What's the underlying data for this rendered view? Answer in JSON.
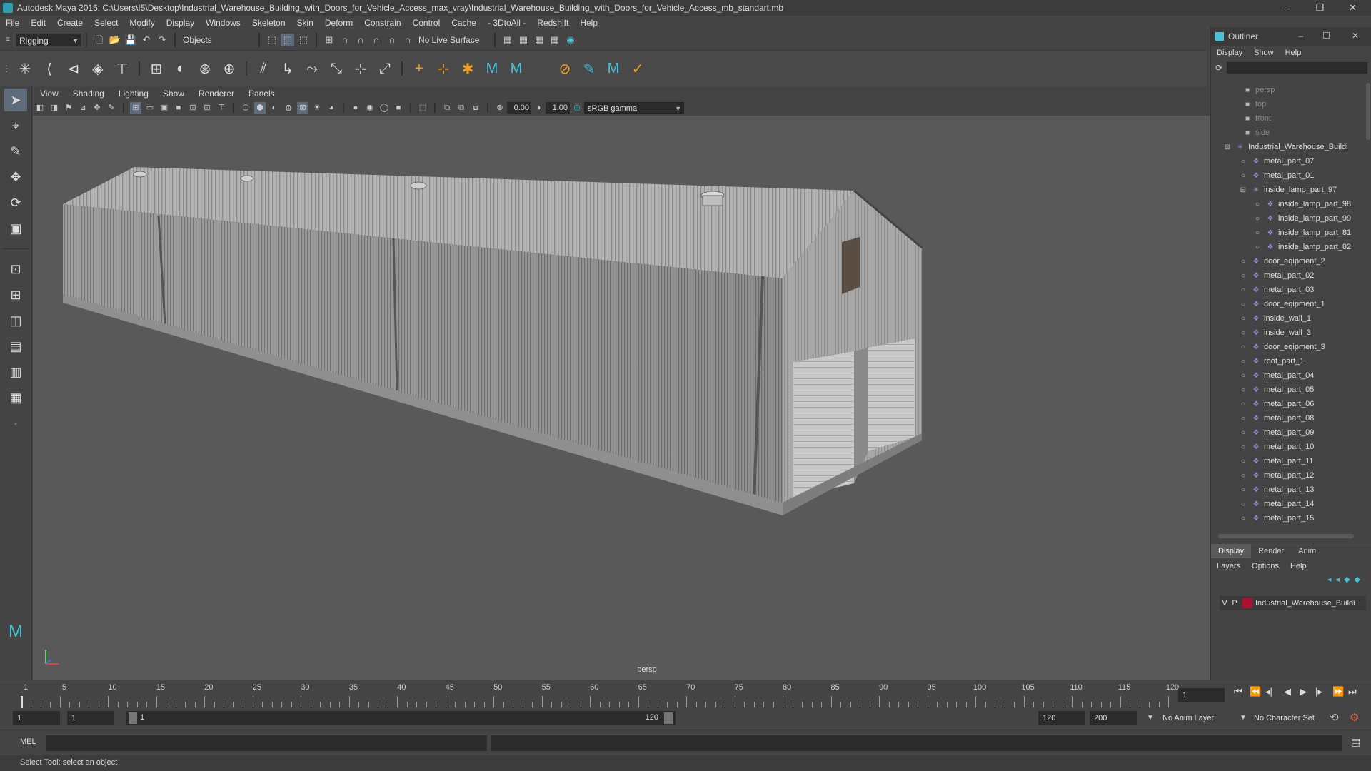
{
  "window": {
    "title": "Autodesk Maya 2016: C:\\Users\\I5\\Desktop\\Industrial_Warehouse_Building_with_Doors_for_Vehicle_Access_max_vray\\Industrial_Warehouse_Building_with_Doors_for_Vehicle_Access_mb_standart.mb",
    "minimize": "–",
    "maximize": "❐",
    "close": "✕"
  },
  "menubar": {
    "items": [
      "File",
      "Edit",
      "Create",
      "Select",
      "Modify",
      "Display",
      "Windows",
      "Skeleton",
      "Skin",
      "Deform",
      "Constrain",
      "Control",
      "Cache",
      "- 3DtoAll -",
      "Redshift",
      "Help"
    ]
  },
  "statusline": {
    "mode": "Rigging",
    "selection_mode": "Objects",
    "live_surface": "No Live Surface"
  },
  "viewport": {
    "menu": [
      "View",
      "Shading",
      "Lighting",
      "Show",
      "Renderer",
      "Panels"
    ],
    "exposure": "0.00",
    "gamma": "1.00",
    "color_space": "sRGB gamma",
    "camera_label": "persp"
  },
  "outliner": {
    "title": "Outliner",
    "menu": [
      "Display",
      "Show",
      "Help"
    ],
    "items": [
      {
        "label": "persp",
        "kind": "camera",
        "depth": 1
      },
      {
        "label": "top",
        "kind": "camera",
        "depth": 1
      },
      {
        "label": "front",
        "kind": "camera",
        "depth": 1
      },
      {
        "label": "side",
        "kind": "camera",
        "depth": 1
      },
      {
        "label": "Industrial_Warehouse_Buildi",
        "kind": "group",
        "depth": 0
      },
      {
        "label": "metal_part_07",
        "kind": "mesh",
        "depth": 1
      },
      {
        "label": "metal_part_01",
        "kind": "mesh",
        "depth": 1
      },
      {
        "label": "inside_lamp_part_97",
        "kind": "group",
        "depth": 1
      },
      {
        "label": "inside_lamp_part_98",
        "kind": "mesh",
        "depth": 2
      },
      {
        "label": "inside_lamp_part_99",
        "kind": "mesh",
        "depth": 2
      },
      {
        "label": "inside_lamp_part_81",
        "kind": "mesh",
        "depth": 2
      },
      {
        "label": "inside_lamp_part_82",
        "kind": "mesh",
        "depth": 2
      },
      {
        "label": "door_eqipment_2",
        "kind": "mesh",
        "depth": 1
      },
      {
        "label": "metal_part_02",
        "kind": "mesh",
        "depth": 1
      },
      {
        "label": "metal_part_03",
        "kind": "mesh",
        "depth": 1
      },
      {
        "label": "door_eqipment_1",
        "kind": "mesh",
        "depth": 1
      },
      {
        "label": "inside_wall_1",
        "kind": "mesh",
        "depth": 1
      },
      {
        "label": "inside_wall_3",
        "kind": "mesh",
        "depth": 1
      },
      {
        "label": "door_eqipment_3",
        "kind": "mesh",
        "depth": 1
      },
      {
        "label": "roof_part_1",
        "kind": "mesh",
        "depth": 1
      },
      {
        "label": "metal_part_04",
        "kind": "mesh",
        "depth": 1
      },
      {
        "label": "metal_part_05",
        "kind": "mesh",
        "depth": 1
      },
      {
        "label": "metal_part_06",
        "kind": "mesh",
        "depth": 1
      },
      {
        "label": "metal_part_08",
        "kind": "mesh",
        "depth": 1
      },
      {
        "label": "metal_part_09",
        "kind": "mesh",
        "depth": 1
      },
      {
        "label": "metal_part_10",
        "kind": "mesh",
        "depth": 1
      },
      {
        "label": "metal_part_11",
        "kind": "mesh",
        "depth": 1
      },
      {
        "label": "metal_part_12",
        "kind": "mesh",
        "depth": 1
      },
      {
        "label": "metal_part_13",
        "kind": "mesh",
        "depth": 1
      },
      {
        "label": "metal_part_14",
        "kind": "mesh",
        "depth": 1
      },
      {
        "label": "metal_part_15",
        "kind": "mesh",
        "depth": 1
      }
    ]
  },
  "layers": {
    "tabs": [
      "Display",
      "Render",
      "Anim"
    ],
    "active_tab": "Display",
    "menu": [
      "Layers",
      "Options",
      "Help"
    ],
    "rows": [
      {
        "v": "V",
        "p": "P",
        "name": "Industrial_Warehouse_Buildi",
        "color": "#b01030"
      }
    ]
  },
  "timeline": {
    "ticks": [
      1,
      5,
      10,
      15,
      20,
      25,
      30,
      35,
      40,
      45,
      50,
      55,
      60,
      65,
      70,
      75,
      80,
      85,
      90,
      95,
      100,
      105,
      110,
      115,
      120
    ],
    "start": 1,
    "end": 120,
    "current_frame": "1"
  },
  "range": {
    "start_time": "1",
    "playback_start": "1",
    "range_slider_start": "1",
    "range_slider_end": "120",
    "playback_end": "120",
    "end_time": "200",
    "anim_layer": "No Anim Layer",
    "character_set": "No Character Set"
  },
  "command": {
    "language": "MEL"
  },
  "help_line": "Select Tool: select an object",
  "colors": {
    "accent": "#47c1d6",
    "selected_tool": "#5d6b7a",
    "layer_color": "#b01030"
  }
}
